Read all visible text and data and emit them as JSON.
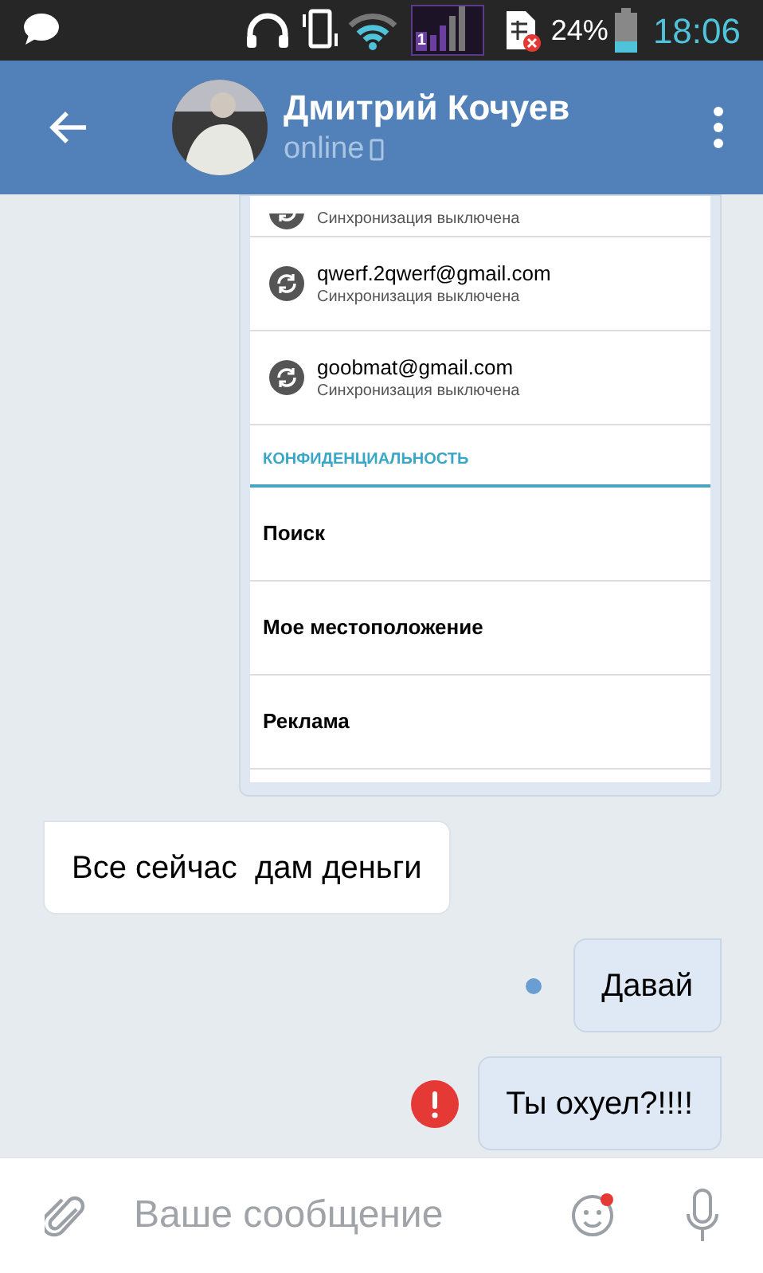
{
  "status_bar": {
    "sim_label": "1",
    "battery": "24%",
    "time": "18:06"
  },
  "header": {
    "name": "Дмитрий Кочуев",
    "status": "online"
  },
  "messages": [
    {
      "kind": "screenshot",
      "accounts": [
        {
          "sync": "Синхронизация выключена"
        },
        {
          "email": "qwerf.2qwerf@gmail.com",
          "sync": "Синхронизация выключена"
        },
        {
          "email": "goobmat@gmail.com",
          "sync": "Синхронизация выключена"
        }
      ],
      "section": "КОНФИДЕНЦИАЛЬНОСТЬ",
      "items": [
        "Поиск",
        "Мое местоположение",
        "Реклама"
      ]
    },
    {
      "kind": "text",
      "outgoing": false,
      "text": "Все сейчас  дам деньги",
      "unread": false,
      "failed": false
    },
    {
      "kind": "text",
      "outgoing": true,
      "text": "Давай",
      "unread": true,
      "failed": false
    },
    {
      "kind": "text",
      "outgoing": true,
      "text": "Ты охуел?!!!!",
      "unread": false,
      "failed": true
    }
  ],
  "composer": {
    "placeholder": "Ваше сообщение"
  }
}
